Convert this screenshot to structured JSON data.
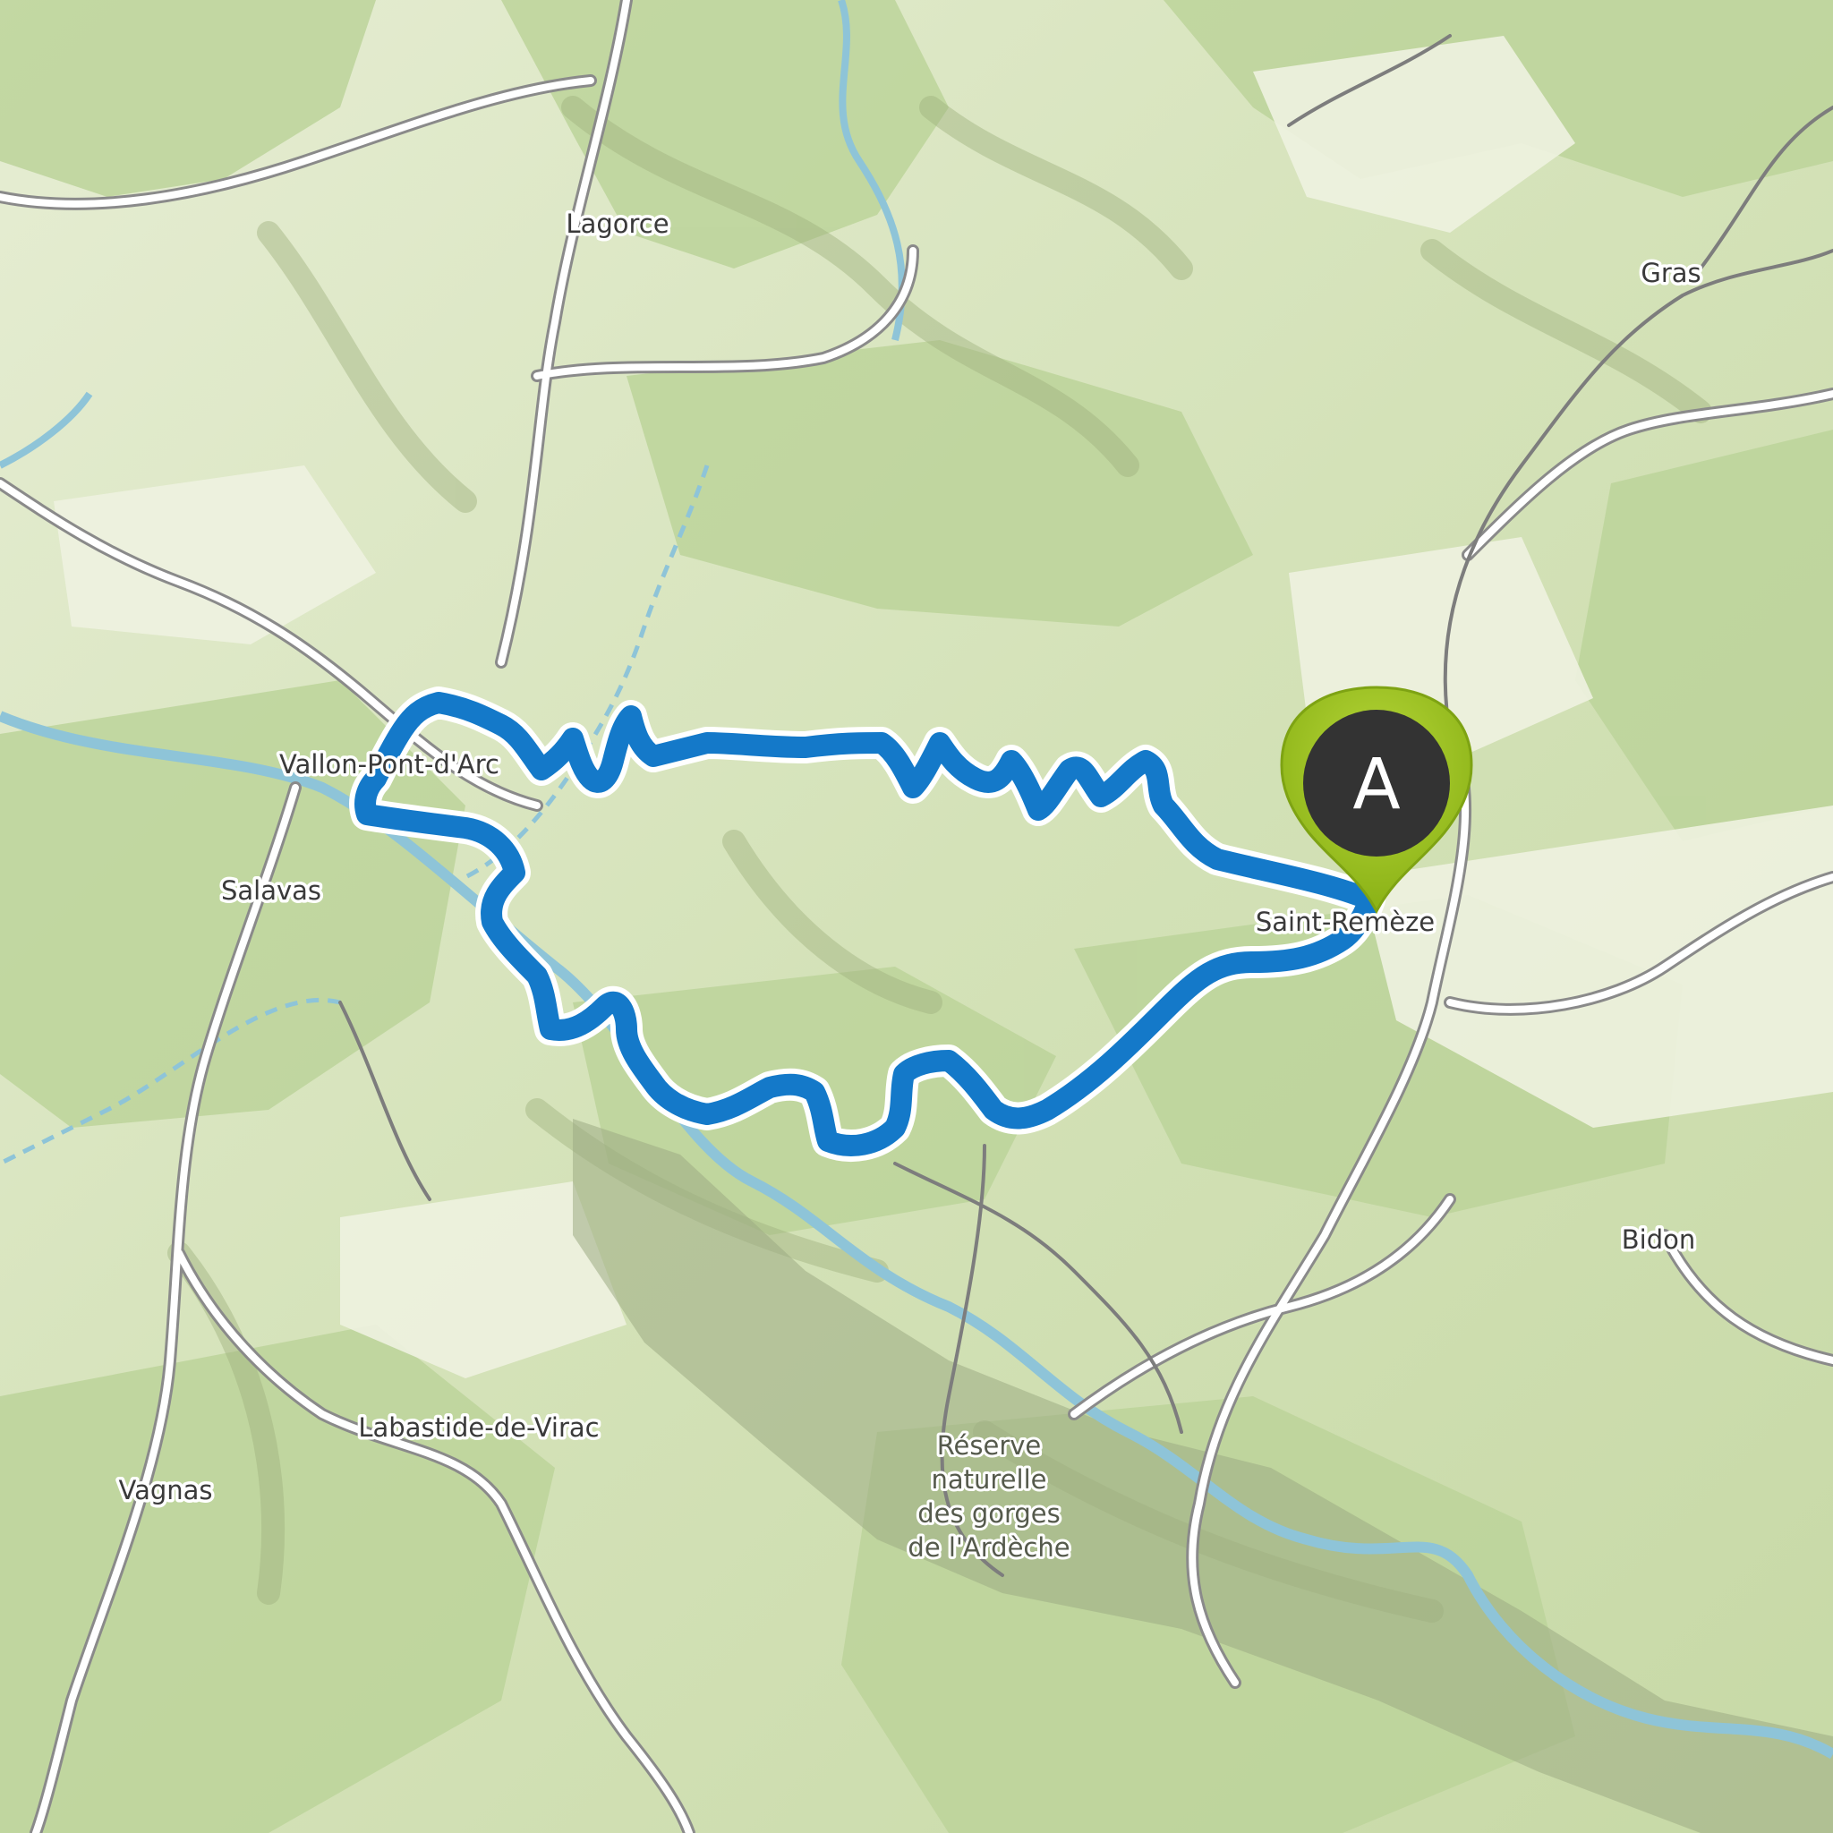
{
  "map": {
    "places": [
      {
        "id": "lagorce",
        "name": "Lagorce"
      },
      {
        "id": "gras",
        "name": "Gras"
      },
      {
        "id": "vallon",
        "name": "Vallon-Pont-d'Arc"
      },
      {
        "id": "salavas",
        "name": "Salavas"
      },
      {
        "id": "saint-remeze",
        "name": "Saint-Remèze"
      },
      {
        "id": "bidon",
        "name": "Bidon"
      },
      {
        "id": "labastide",
        "name": "Labastide-de-Virac"
      },
      {
        "id": "vagnas",
        "name": "Vagnas"
      }
    ],
    "reserve_label": [
      "Réserve",
      "naturelle",
      "des gorges",
      "de l'Ardèche"
    ],
    "route": {
      "color": "#1479c9",
      "type": "loop"
    },
    "start_marker": {
      "letter": "A",
      "color": "#9ac21d"
    }
  }
}
